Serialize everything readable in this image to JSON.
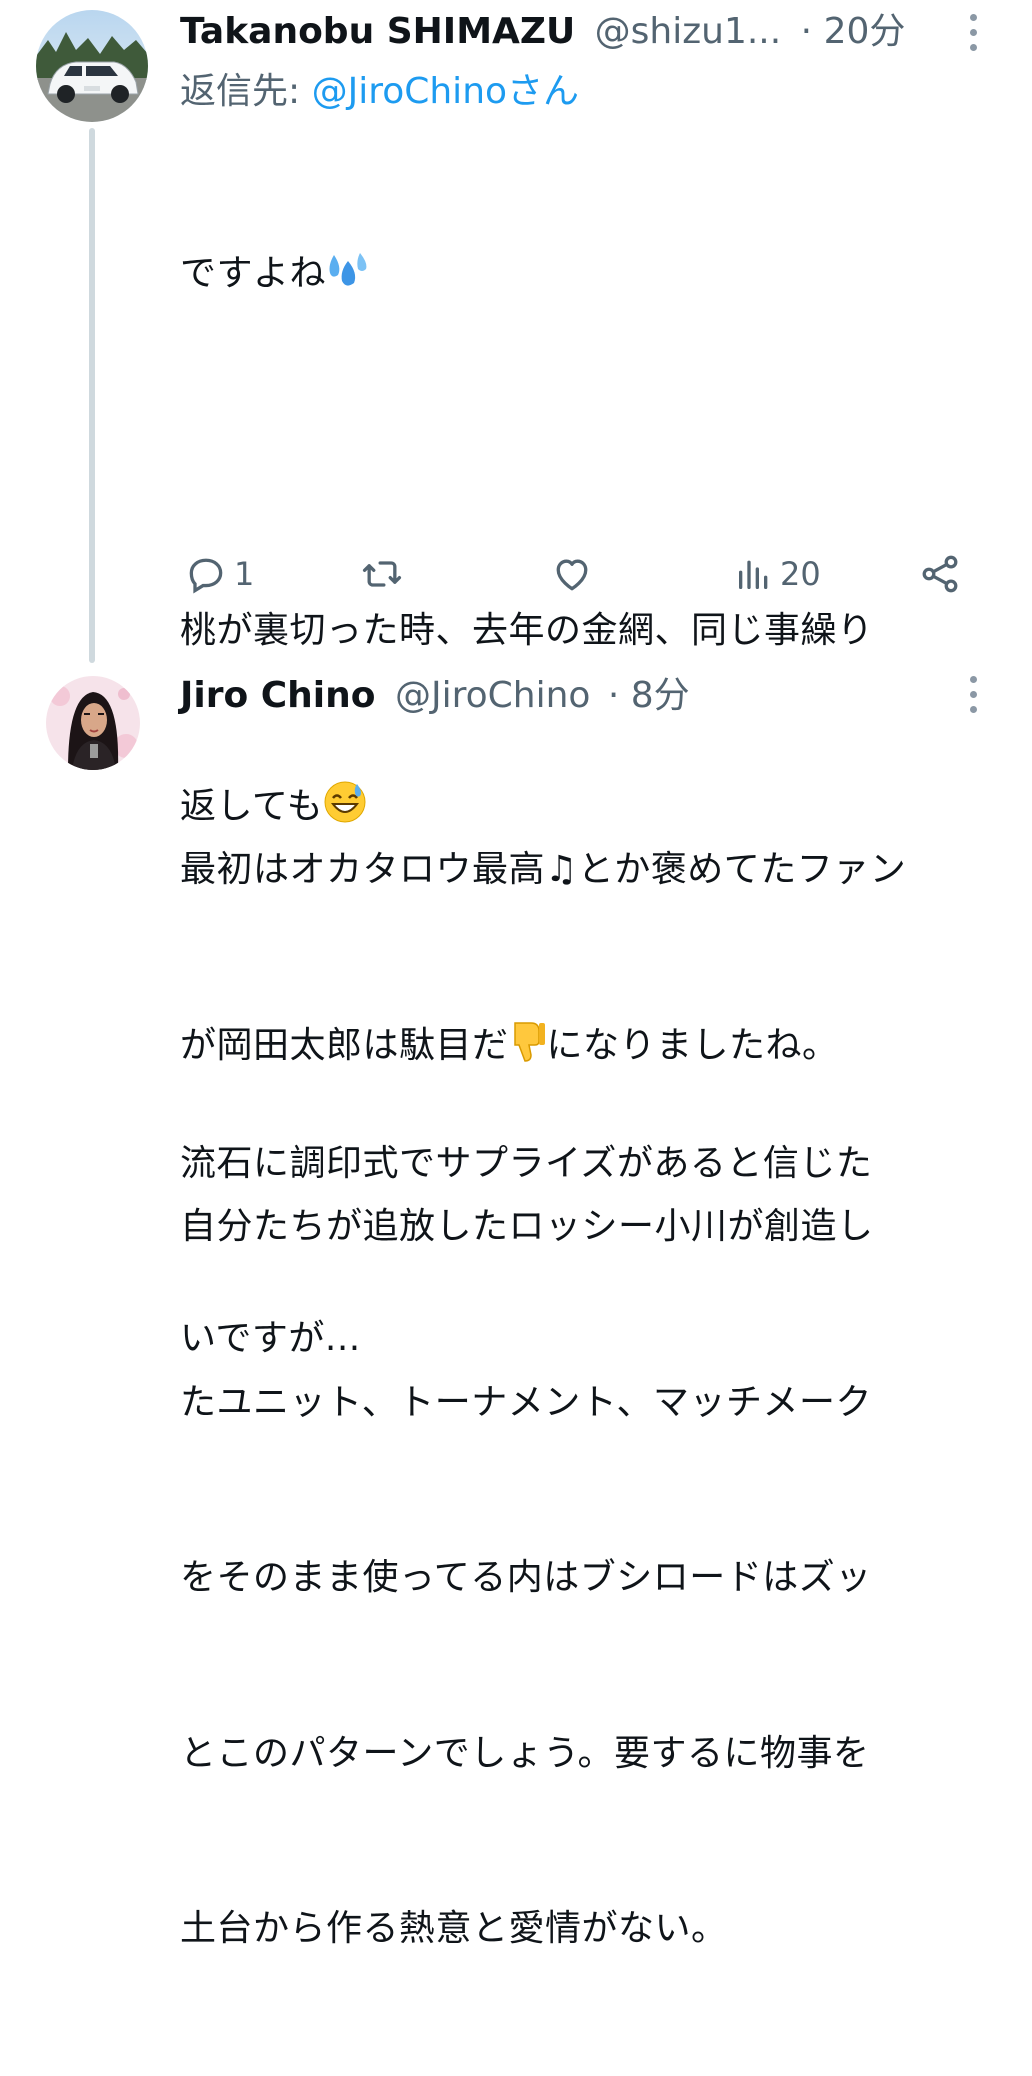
{
  "tweets": [
    {
      "display_name": "Takanobu SHIMAZU",
      "handle": "@shizu1...",
      "separator": "·",
      "time": "20分",
      "reply_prefix": "返信先: ",
      "reply_mention": "@JiroChinoさん",
      "body_lines": [
        "ですよね",
        "",
        "桃が裏切った時、去年の金網、同じ事繰り",
        "返しても",
        "",
        "流石に調印式でサプライズがあると信じた",
        "いですが..."
      ],
      "stats": {
        "replies": "1",
        "reposts": "",
        "likes": "",
        "views": "20"
      }
    },
    {
      "display_name": "Jiro Chino",
      "handle": "@JiroChino",
      "separator": "·",
      "time": "8分",
      "body_lines": [
        "最初はオカタロウ最高♫とか褒めてたファン",
        "が岡田太郎は駄目だ",
        "自分たちが追放したロッシー小川が創造し",
        "たユニット、トーナメント、マッチメーク",
        "をそのまま使ってる内はブシロードはズッ",
        "とこのパターンでしょう。要するに物事を",
        "土台から作る熱意と愛情がない。"
      ],
      "line2_suffix": "になりましたね。"
    }
  ],
  "icons": {
    "reply": "reply-icon",
    "repost": "repost-icon",
    "like": "heart-icon",
    "views": "views-icon",
    "share": "share-icon",
    "more": "more-vertical-icon"
  },
  "colors": {
    "text": "#0f1419",
    "secondary": "#536471",
    "link": "#1d9bf0",
    "thread_line": "#cfd9de"
  }
}
